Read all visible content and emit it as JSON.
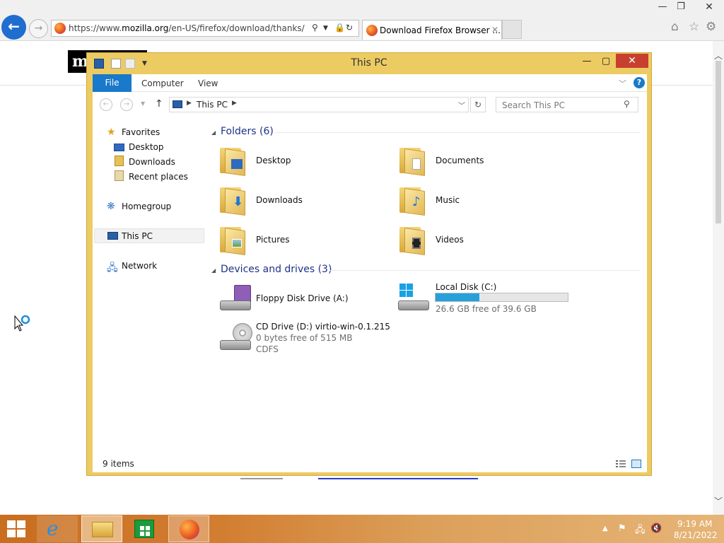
{
  "browser": {
    "address_url_prefix": "https://www.",
    "address_url_domain": "mozilla.org",
    "address_url_rest": "/en-US/firefox/download/thanks/",
    "tab_title": "Download Firefox Browser ...",
    "window_buttons": {
      "minimize": "—",
      "restore": "❐",
      "close": "✕"
    }
  },
  "explorer": {
    "title": "This PC",
    "ribbon_tabs": {
      "file": "File",
      "computer": "Computer",
      "view": "View"
    },
    "breadcrumb": "This PC",
    "search_placeholder": "Search This PC",
    "nav_pane": {
      "favorites": "Favorites",
      "desktop": "Desktop",
      "downloads": "Downloads",
      "recent_places": "Recent places",
      "homegroup": "Homegroup",
      "this_pc": "This PC",
      "network": "Network"
    },
    "folders_header": "Folders (6)",
    "folders": {
      "desktop": "Desktop",
      "documents": "Documents",
      "downloads": "Downloads",
      "music": "Music",
      "pictures": "Pictures",
      "videos": "Videos"
    },
    "devices_header": "Devices and drives (3)",
    "drives": {
      "floppy": {
        "name": "Floppy Disk Drive (A:)"
      },
      "local_disk": {
        "name": "Local Disk (C:)",
        "free_text": "26.6 GB free of 39.6 GB",
        "used_fraction": 0.33
      },
      "cd": {
        "name": "CD Drive (D:) virtio-win-0.1.215",
        "free_text": "0 bytes free of 515 MB",
        "fs": "CDFS"
      }
    },
    "status": "9 items"
  },
  "taskbar": {
    "time": "9:19 AM",
    "date": "8/21/2022"
  },
  "colors": {
    "explorer_frame": "#eccb63",
    "ribbon_file": "#1979ca",
    "close_button": "#c7402f",
    "group_header": "#1e3287",
    "disk_fill": "#26a0da"
  }
}
